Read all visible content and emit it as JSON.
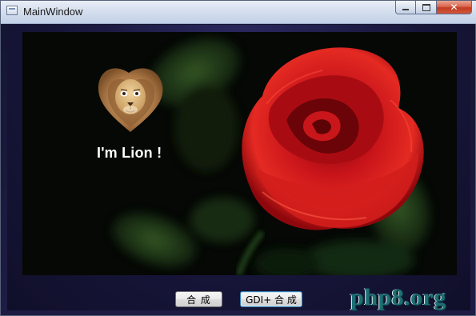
{
  "window": {
    "title": "MainWindow",
    "caption_buttons": {
      "close_glyph": "✕"
    }
  },
  "picture": {
    "caption": "I'm Lion !",
    "images": [
      "lion-heart-image",
      "red-rose-image"
    ]
  },
  "buttons": {
    "compose_label": "合 成",
    "gdi_compose_label": "GDI+ 合 成"
  },
  "watermark": {
    "text": "php8.org"
  },
  "colors": {
    "title_bar": "#d2dced",
    "client_background": "#17163a",
    "picture_background": "#050805",
    "rose": "#c8141a",
    "caption_text": "#ffffff",
    "watermark": "#1d6f74"
  }
}
